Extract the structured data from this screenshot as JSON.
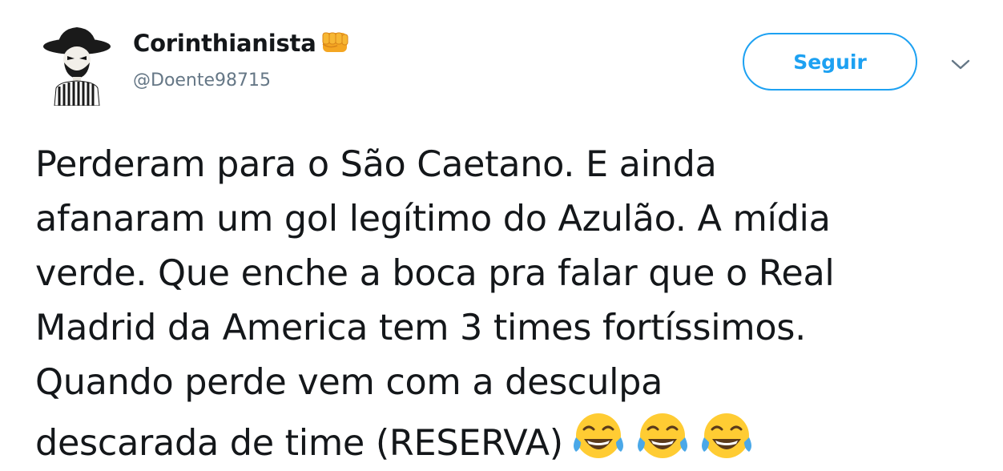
{
  "tweet": {
    "author": {
      "display_name": "Corinthianista",
      "handle": "@Doente98715",
      "name_emoji": "fist-icon",
      "avatar_icon": "avatar-icon"
    },
    "follow_label": "Seguir",
    "menu_icon": "chevron-down-icon",
    "text_lines": [
      "Perderam para o São Caetano. E ainda",
      "afanaram um gol legítimo do Azulão. A mídia",
      "verde. Que enche a boca pra falar que o Real",
      "Madrid da America tem 3 times fortíssimos.",
      "Quando perde vem com a desculpa",
      "descarada de time (RESERVA)"
    ],
    "trailing_emojis": [
      "tears-of-joy-emoji-icon",
      "tears-of-joy-emoji-icon",
      "tears-of-joy-emoji-icon"
    ]
  },
  "colors": {
    "accent": "#1da1f2",
    "text": "#14171a",
    "secondary_text": "#657786"
  }
}
